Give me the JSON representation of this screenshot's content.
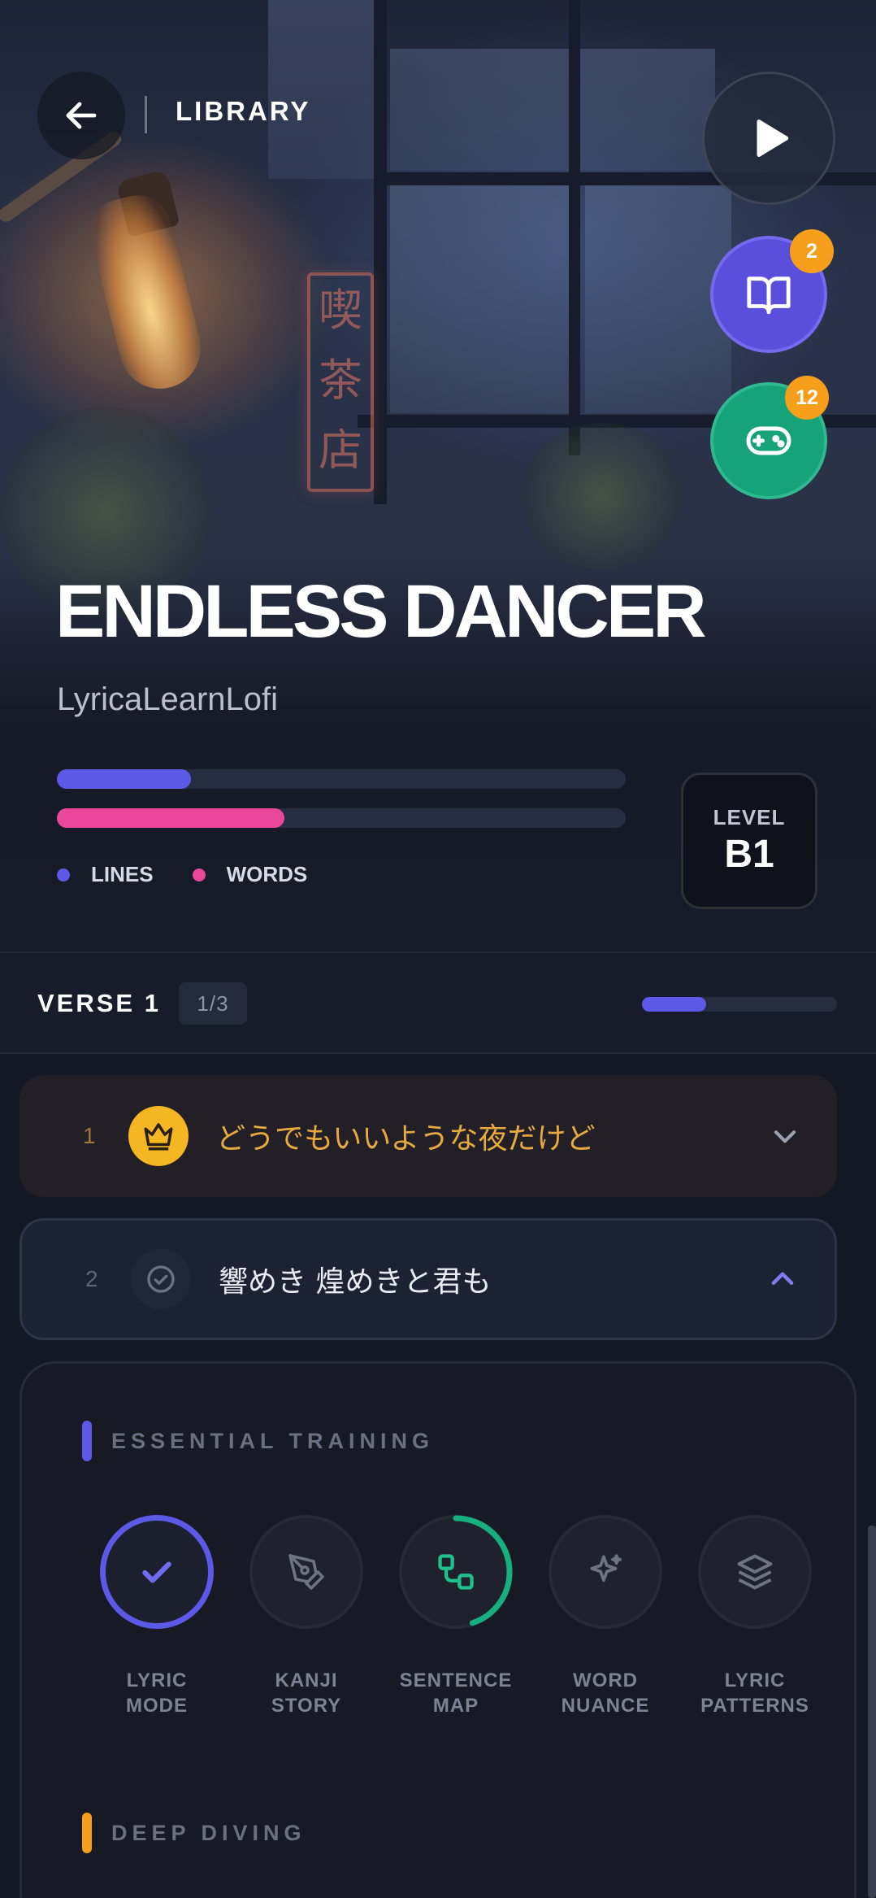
{
  "header": {
    "back_icon": "arrow-left-icon",
    "title": "LIBRARY"
  },
  "actions": {
    "play_icon": "play-icon",
    "book": {
      "icon": "open-book-icon",
      "badge": "2",
      "color": "#5a4fdc"
    },
    "game": {
      "icon": "gamepad-icon",
      "badge": "12",
      "color": "#16a37a"
    }
  },
  "song": {
    "title": "ENDLESS DANCER",
    "artist": "LyricaLearnLofi"
  },
  "progress": {
    "lines": {
      "label": "LINES",
      "fraction": 0.235,
      "color": "#5b59e6"
    },
    "words": {
      "label": "WORDS",
      "fraction": 0.4,
      "color": "#e8479a"
    }
  },
  "level": {
    "label": "LEVEL",
    "value": "B1"
  },
  "verse": {
    "label": "VERSE 1",
    "count": "1/3",
    "fraction": 0.33
  },
  "lines": [
    {
      "number": "1",
      "text": "どうでもいいような夜だけど",
      "icon": "crown-icon",
      "state": "current"
    },
    {
      "number": "2",
      "text": "響めき 煌めきと君も",
      "icon": "check-circle-icon",
      "state": "expanded"
    }
  ],
  "training": {
    "essential_title": "ESSENTIAL TRAINING",
    "modes": [
      {
        "label": "LYRIC\nMODE",
        "icon": "check-icon",
        "status": "complete"
      },
      {
        "label": "KANJI\nSTORY",
        "icon": "pen-nib-icon",
        "status": "locked"
      },
      {
        "label": "SENTENCE\nMAP",
        "icon": "nodes-icon",
        "status": "in-progress",
        "progress": 0.45
      },
      {
        "label": "WORD\nNUANCE",
        "icon": "sparkle-icon",
        "status": "locked"
      },
      {
        "label": "LYRIC\nPATTERNS",
        "icon": "layers-icon",
        "status": "locked"
      }
    ],
    "deep_title": "DEEP DIVING"
  },
  "colors": {
    "accent_indigo": "#5b59e6",
    "accent_pink": "#e8479a",
    "accent_amber": "#f59f1a",
    "accent_green": "#16a37a"
  }
}
